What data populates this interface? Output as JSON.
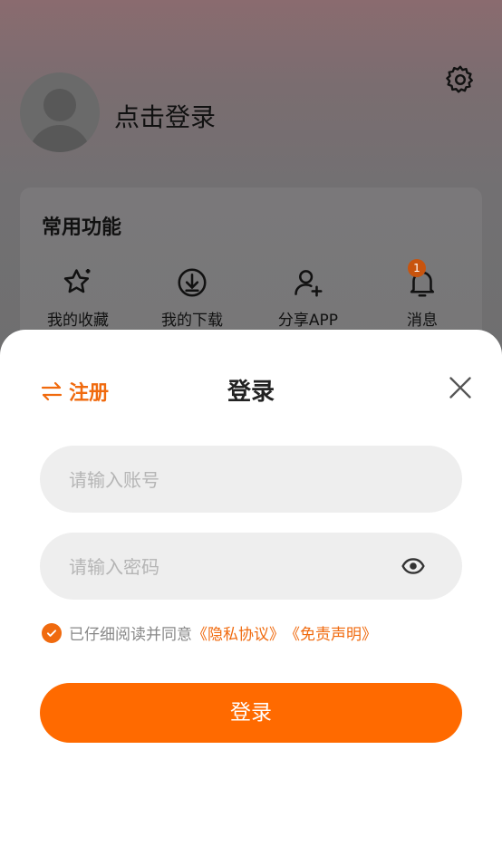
{
  "profile": {
    "login_prompt": "点击登录"
  },
  "common": {
    "title": "常用功能",
    "items": [
      {
        "label": "我的收藏",
        "icon": "star-icon"
      },
      {
        "label": "我的下载",
        "icon": "download-icon"
      },
      {
        "label": "分享APP",
        "icon": "share-user-icon"
      },
      {
        "label": "消息",
        "icon": "bell-icon",
        "badge": "1"
      }
    ]
  },
  "sheet": {
    "register_label": "注册",
    "title": "登录",
    "account_placeholder": "请输入账号",
    "password_placeholder": "请输入密码",
    "agree_text": "已仔细阅读并同意",
    "privacy_link": "《隐私协议》",
    "disclaimer_link": "《免责声明》",
    "submit_label": "登录"
  },
  "colors": {
    "accent": "#ff6a00",
    "accent_text": "#f06a0e",
    "field_bg": "#eeeeee"
  }
}
